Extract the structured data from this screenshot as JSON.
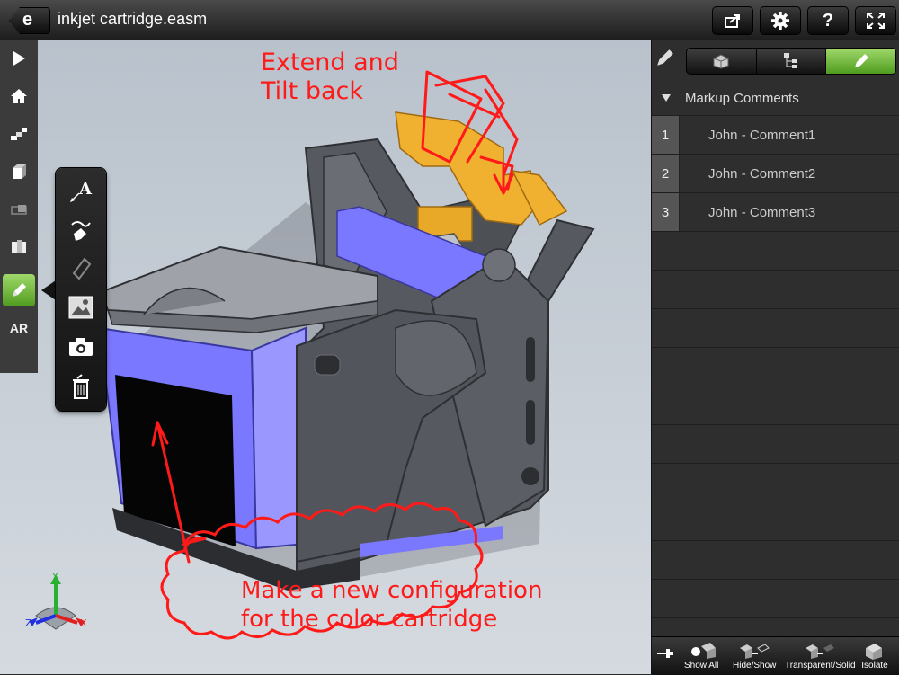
{
  "app": {
    "logo_text": "e",
    "title": "inkjet cartridge.easm"
  },
  "toolbar": {
    "share_icon": "share-icon",
    "settings_icon": "gear-icon",
    "help_label": "?",
    "fullscreen_icon": "fullscreen-icon"
  },
  "left_tools": {
    "items": [
      {
        "icon": "play-icon"
      },
      {
        "icon": "home-icon"
      },
      {
        "icon": "explode-icon"
      },
      {
        "icon": "views-icon"
      },
      {
        "icon": "section-icon"
      },
      {
        "icon": "configuration-icon"
      },
      {
        "icon": "markup-pencil-icon",
        "active": true
      },
      {
        "label": "AR"
      }
    ]
  },
  "markup_popover": {
    "text_tool_label": "A",
    "items": [
      "text-icon",
      "freehand-icon",
      "eraser-icon",
      "image-icon",
      "camera-icon",
      "trash-icon"
    ]
  },
  "annotations": {
    "note1_line1": "Extend and",
    "note1_line2": "Tilt back",
    "cloud_line1": "Make a new configuration",
    "cloud_line2": "for the color cartridge"
  },
  "triad": {
    "x": "X",
    "y": "Y",
    "z": "Z"
  },
  "side_panel": {
    "tabs": [
      "parts-icon",
      "tree-icon",
      "markup-icon"
    ],
    "active_tab": 2,
    "section_title": "Markup Comments",
    "comments": [
      {
        "num": "1",
        "text": "John - Comment1"
      },
      {
        "num": "2",
        "text": "John - Comment2"
      },
      {
        "num": "3",
        "text": "John - Comment3"
      }
    ]
  },
  "bottom_bar": {
    "show_all": "Show All",
    "hide_show": "Hide/Show",
    "transparent_solid": "Transparent/Solid",
    "isolate": "Isolate"
  },
  "colors": {
    "accent_green": "#6fbf3a",
    "annotation_red": "#ff1a1a",
    "part_blue": "#7a78ff",
    "part_gray": "#56595f",
    "part_gold": "#f0b030"
  }
}
